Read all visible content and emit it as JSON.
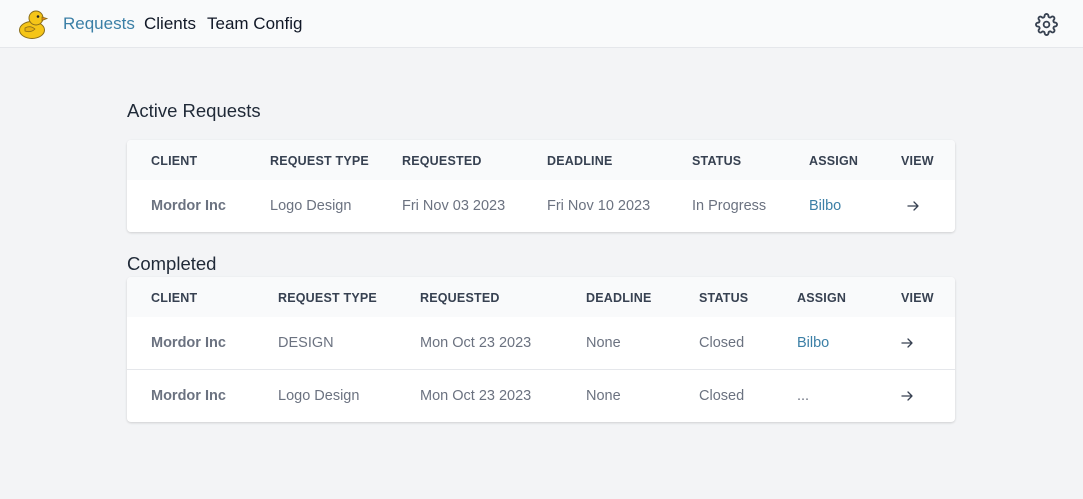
{
  "nav": {
    "links": [
      {
        "label": "Requests",
        "active": true
      },
      {
        "label": "Clients",
        "active": false
      },
      {
        "label": "Team Config",
        "active": false
      }
    ],
    "logo_icon": "duck-logo-icon",
    "settings_icon": "gear-icon"
  },
  "colors": {
    "accent": "#3b7fa6",
    "background": "#f3f4f6",
    "navbar": "#f9fafb",
    "card": "#ffffff",
    "header_row": "#f9fafb",
    "muted_text": "#6b7280"
  },
  "active": {
    "title": "Active Requests",
    "columns": [
      "CLIENT",
      "REQUEST TYPE",
      "REQUESTED",
      "DEADLINE",
      "STATUS",
      "ASSIGN",
      "VIEW"
    ],
    "rows": [
      {
        "client": "Mordor Inc",
        "request_type": "Logo Design",
        "requested": "Fri Nov 03 2023",
        "deadline": "Fri Nov 10 2023",
        "status": "In Progress",
        "assign": "Bilbo",
        "view_icon": "arrow-right-icon"
      }
    ]
  },
  "completed": {
    "title": "Completed",
    "columns": [
      "CLIENT",
      "REQUEST TYPE",
      "REQUESTED",
      "DEADLINE",
      "STATUS",
      "ASSIGN",
      "VIEW"
    ],
    "rows": [
      {
        "client": "Mordor Inc",
        "request_type": "DESIGN",
        "requested": "Mon Oct 23 2023",
        "deadline": "None",
        "status": "Closed",
        "assign": "Bilbo",
        "view_icon": "arrow-right-icon"
      },
      {
        "client": "Mordor Inc",
        "request_type": "Logo Design",
        "requested": "Mon Oct 23 2023",
        "deadline": "None",
        "status": "Closed",
        "assign": "...",
        "view_icon": "arrow-right-icon"
      }
    ]
  }
}
